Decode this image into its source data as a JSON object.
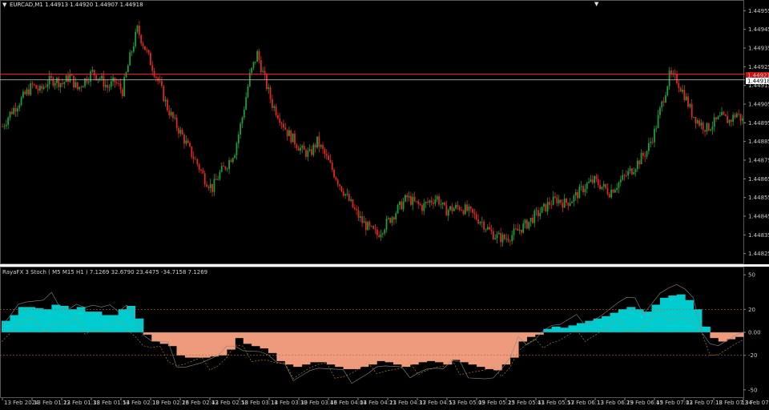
{
  "header": {
    "symbol_line": "EURCAD,M1  1.44913 1.44920 1.44907 1.44918",
    "menu_arrow_icon": "triangle-down-icon"
  },
  "price_axis": {
    "ticks": [
      "1.44955",
      "1.44945",
      "1.44935",
      "1.44925",
      "1.44915",
      "1.44905",
      "1.44895",
      "1.44885",
      "1.44875",
      "1.44865",
      "1.44855",
      "1.44845",
      "1.44835",
      "1.44825"
    ],
    "current_price": "1.44918",
    "red_line_price": "1.44921",
    "min": 1.44821,
    "max": 1.44959
  },
  "indicator": {
    "title": "RayaFX 3 Stoch ( M5  M15  H1 ) 7.1269 32.6790 23.4475 -34.7158 7.1269",
    "ticks": [
      "50",
      "20",
      "0.00",
      "-20",
      "-50"
    ],
    "levels": [
      50,
      20,
      0,
      -20,
      -50
    ]
  },
  "time_axis": {
    "labels": [
      "13 Feb 2024",
      "13 Feb 01:22",
      "13 Feb 01:38",
      "13 Feb 01:54",
      "13 Feb 02:10",
      "13 Feb 02:26",
      "13 Feb 02:42",
      "13 Feb 02:58",
      "13 Feb 03:14",
      "13 Feb 03:30",
      "13 Feb 03:46",
      "13 Feb 04:04",
      "13 Feb 04:21",
      "13 Feb 04:37",
      "13 Feb 04:53",
      "13 Feb 05:09",
      "13 Feb 05:25",
      "13 Feb 05:41",
      "13 Feb 05:57",
      "13 Feb 06:13",
      "13 Feb 06:29",
      "13 Feb 06:45",
      "13 Feb 07:02",
      "13 Feb 07:18",
      "13 Feb 07:34",
      "13 Feb 07:50"
    ]
  },
  "colors": {
    "bull": "#1e9e3a",
    "bear": "#e0281c",
    "pos_fill": "#00ccd0",
    "neg_fill": "#ee9a7c",
    "axis_bg": "#000000",
    "red_line": "#ff2222",
    "price_line": "#b0b0b0",
    "label_bg": "#cc1111"
  },
  "chart_data": {
    "type": "line",
    "title": "EURCAD,M1",
    "series": [
      {
        "name": "EURCAD",
        "close": [
          1.44893,
          1.449,
          1.44905,
          1.4491,
          1.44915,
          1.44912,
          1.44917,
          1.44918,
          1.44916,
          1.4492,
          1.44913,
          1.44918,
          1.44922,
          1.44919,
          1.44914,
          1.44917,
          1.44912,
          1.4493,
          1.44945,
          1.44935,
          1.44925,
          1.44915,
          1.44903,
          1.44895,
          1.44888,
          1.4488,
          1.44873,
          1.44865,
          1.4486,
          1.44868,
          1.44873,
          1.4488,
          1.44898,
          1.4492,
          1.44932,
          1.44918,
          1.44905,
          1.44898,
          1.4489,
          1.44885,
          1.4488,
          1.44878,
          1.44885,
          1.44878,
          1.4487,
          1.44862,
          1.44855,
          1.44848,
          1.44842,
          1.44838,
          1.44835,
          1.4484,
          1.44845,
          1.4485,
          1.44855,
          1.44852,
          1.4485,
          1.44853,
          1.44855,
          1.44848,
          1.44849,
          1.4485,
          1.44848,
          1.44845,
          1.44842,
          1.44837,
          1.44834,
          1.44833,
          1.44835,
          1.44838,
          1.44841,
          1.44845,
          1.44848,
          1.44852,
          1.44854,
          1.44852,
          1.44854,
          1.44858,
          1.44862,
          1.44864,
          1.44861,
          1.44858,
          1.44862,
          1.44866,
          1.4487,
          1.44875,
          1.4488,
          1.4489,
          1.44905,
          1.4492,
          1.44918,
          1.4491,
          1.449,
          1.44895,
          1.44892,
          1.44895,
          1.44898,
          1.44896,
          1.449,
          1.44895
        ],
        "style": "candles"
      }
    ],
    "indicator_series": [
      {
        "name": "RayaFX 3 Stoch",
        "values": [
          10,
          15,
          22,
          22,
          21,
          20,
          24,
          23,
          20,
          22,
          18,
          18,
          15,
          15,
          20,
          23,
          12,
          -2,
          -8,
          -10,
          -12,
          -20,
          -22,
          -22,
          -22,
          -21,
          -20,
          -15,
          -5,
          -10,
          -12,
          -14,
          -18,
          -25,
          -28,
          -30,
          -28,
          -26,
          -26,
          -28,
          -30,
          -32,
          -32,
          -30,
          -28,
          -25,
          -26,
          -28,
          -30,
          -28,
          -26,
          -25,
          -26,
          -28,
          -24,
          -26,
          -28,
          -30,
          -32,
          -33,
          -28,
          -22,
          -8,
          -4,
          -2,
          3,
          5,
          4,
          6,
          8,
          10,
          12,
          14,
          17,
          20,
          22,
          20,
          18,
          24,
          30,
          32,
          33,
          28,
          20,
          5,
          -5,
          -8,
          -6,
          -4,
          -3
        ],
        "ylim": [
          -55,
          55
        ]
      }
    ]
  }
}
